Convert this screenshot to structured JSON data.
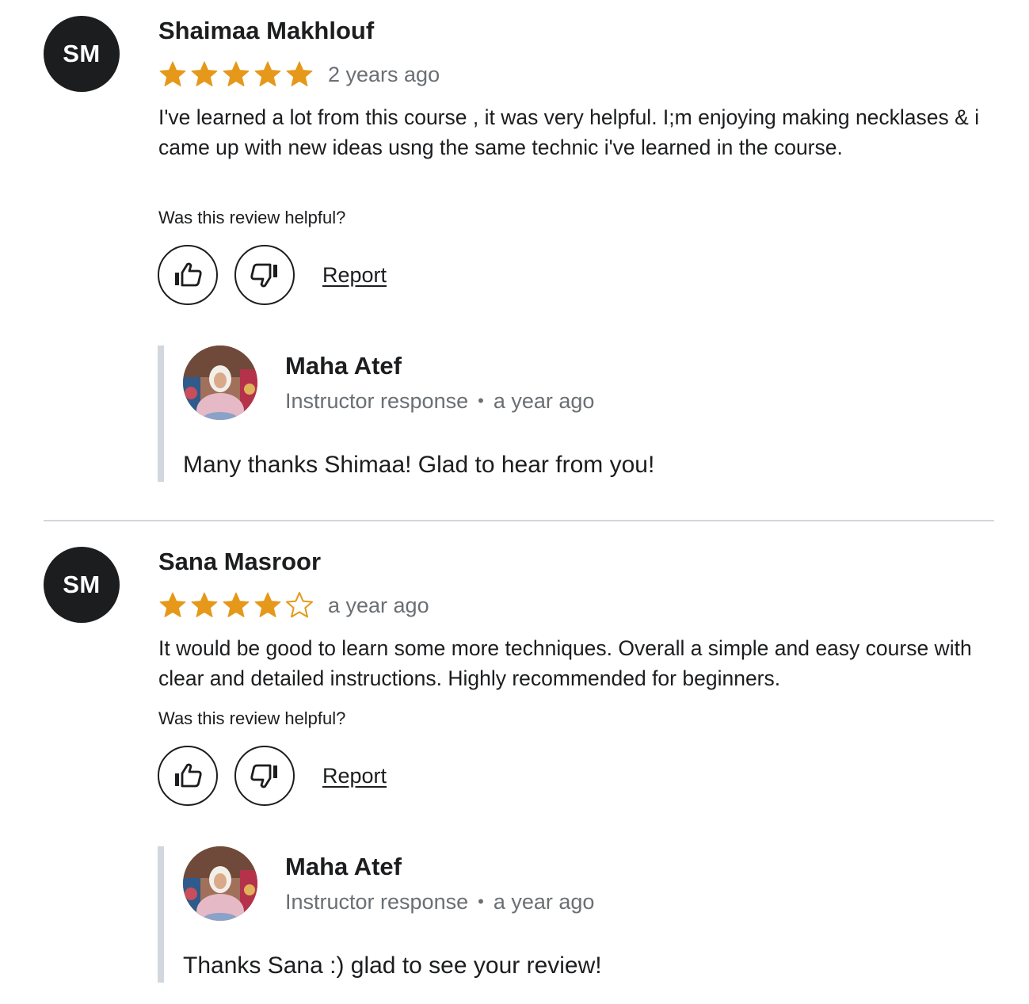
{
  "colors": {
    "star": "#e59819",
    "text": "#1c1d1f",
    "muted": "#6a6f73",
    "divider": "#d1d7dc",
    "avatar_bg": "#1c1d1f"
  },
  "reviews": [
    {
      "initials": "SM",
      "name": "Shaimaa Makhlouf",
      "rating": 5,
      "date": "2 years ago",
      "body": "I've learned a lot from this course , it was very helpful. I;m enjoying making necklases & i came up with new ideas usng the same technic i've learned in the course.",
      "helpful_question": "Was this review helpful?",
      "thumbs_up_icon": "thumbs-up-icon",
      "thumbs_down_icon": "thumbs-down-icon",
      "report_label": "Report",
      "response": {
        "name": "Maha Atef",
        "role": "Instructor response",
        "separator": "•",
        "date": "a year ago",
        "text": "Many thanks Shimaa! Glad to hear from you!"
      }
    },
    {
      "initials": "SM",
      "name": "Sana Masroor",
      "rating": 4,
      "date": "a year ago",
      "body": "It would be good to learn some more techniques. Overall a simple and easy course with clear and detailed instructions. Highly recommended for beginners.",
      "helpful_question": "Was this review helpful?",
      "thumbs_up_icon": "thumbs-up-icon",
      "thumbs_down_icon": "thumbs-down-icon",
      "report_label": "Report",
      "response": {
        "name": "Maha Atef",
        "role": "Instructor response",
        "separator": "•",
        "date": "a year ago",
        "text": "Thanks Sana :) glad to see your review!"
      }
    }
  ]
}
